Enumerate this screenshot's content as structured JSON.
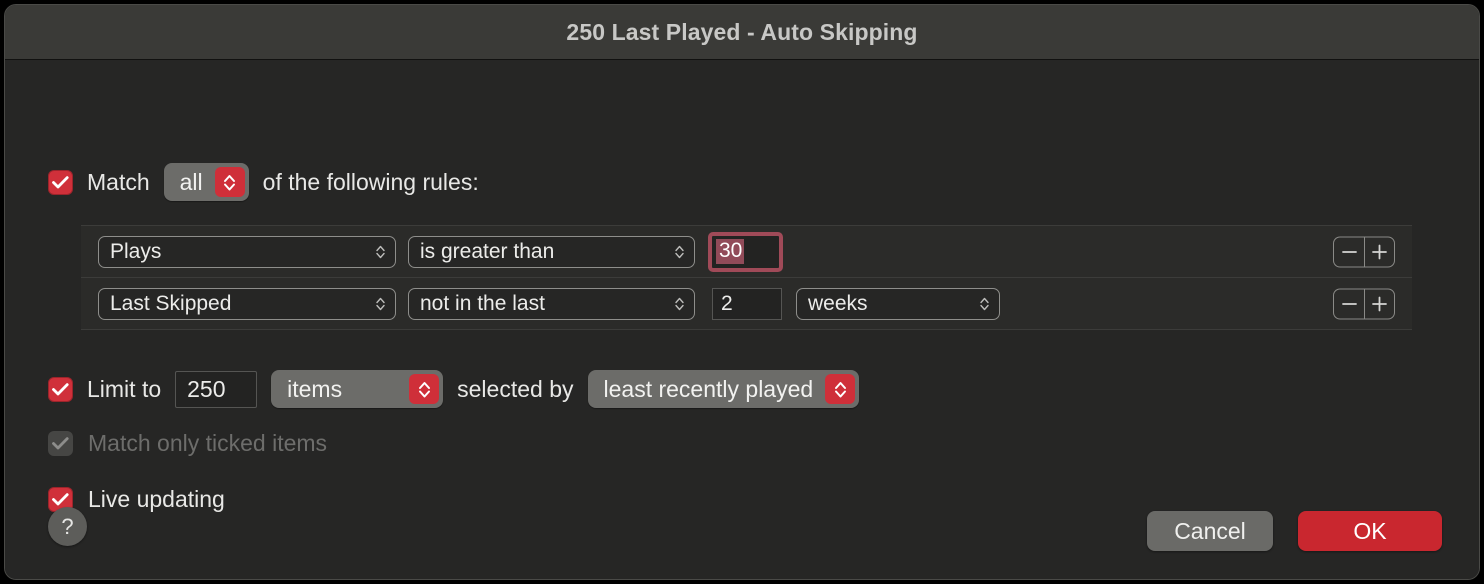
{
  "window": {
    "title": "250 Last Played - Auto Skipping"
  },
  "match": {
    "checkbox_checked": true,
    "label_before": "Match",
    "operator": "all",
    "label_after": "of the following rules:"
  },
  "rules": [
    {
      "field": "Plays",
      "condition": "is greater than",
      "value": "30",
      "value_focused": true,
      "unit": null,
      "remove_label": "−",
      "add_label": "+"
    },
    {
      "field": "Last Skipped",
      "condition": "not in the last",
      "value": "2",
      "value_focused": false,
      "unit": "weeks",
      "remove_label": "−",
      "add_label": "+"
    }
  ],
  "limit": {
    "checkbox_checked": true,
    "label": "Limit to",
    "amount": "250",
    "unit": "items",
    "selected_by_label": "selected by",
    "selected_by": "least recently played"
  },
  "options": [
    {
      "label": "Match only ticked items",
      "checked": true,
      "disabled": true
    },
    {
      "label": "Live updating",
      "checked": true,
      "disabled": false
    }
  ],
  "footer": {
    "help_label": "?",
    "cancel_label": "Cancel",
    "ok_label": "OK"
  },
  "colors": {
    "accent_red": "#cf2f39",
    "default_button_red": "#c9272f",
    "focus_ring": "#a04a58",
    "selection": "#914b59",
    "window_body": "#262625",
    "titlebar": "#3a3a37",
    "popup_grey": "#6c6c69"
  }
}
